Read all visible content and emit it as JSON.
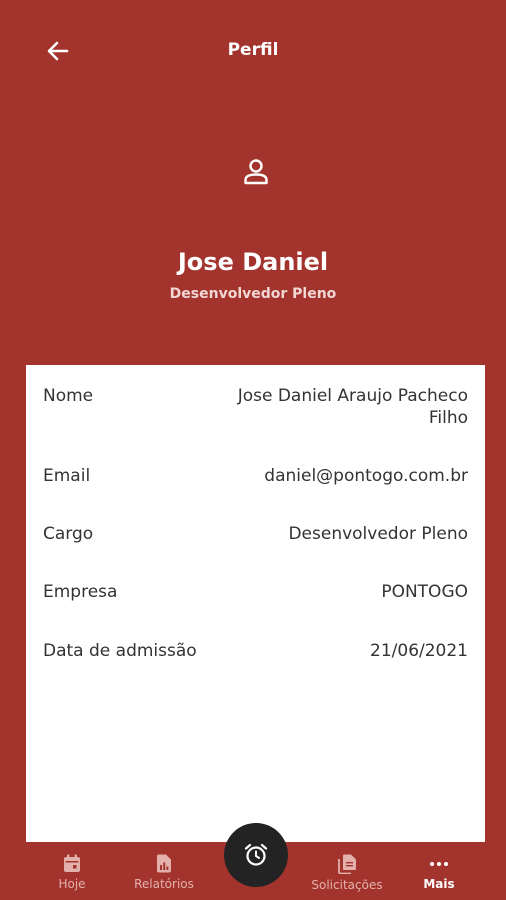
{
  "header": {
    "title": "Perfil"
  },
  "profile": {
    "name": "Jose Daniel",
    "role": "Desenvolvedor Pleno"
  },
  "details": [
    {
      "label": "Nome",
      "value": "Jose Daniel Araujo Pacheco Filho"
    },
    {
      "label": "Email",
      "value": "daniel@pontogo.com.br"
    },
    {
      "label": "Cargo",
      "value": "Desenvolvedor Pleno"
    },
    {
      "label": "Empresa",
      "value": "PONTOGO"
    },
    {
      "label": "Data de admissão",
      "value": "21/06/2021"
    }
  ],
  "nav": {
    "items": [
      {
        "label": "Hoje",
        "icon": "calendar-icon"
      },
      {
        "label": "Relatórios",
        "icon": "report-icon"
      },
      {
        "label": "Solicitações",
        "icon": "documents-icon"
      },
      {
        "label": "Mais",
        "icon": "more-icon"
      }
    ],
    "fab_icon": "alarm-clock-icon",
    "active": "Mais"
  },
  "colors": {
    "primary": "#a3342d",
    "card": "#ffffff",
    "fab": "#232323"
  }
}
